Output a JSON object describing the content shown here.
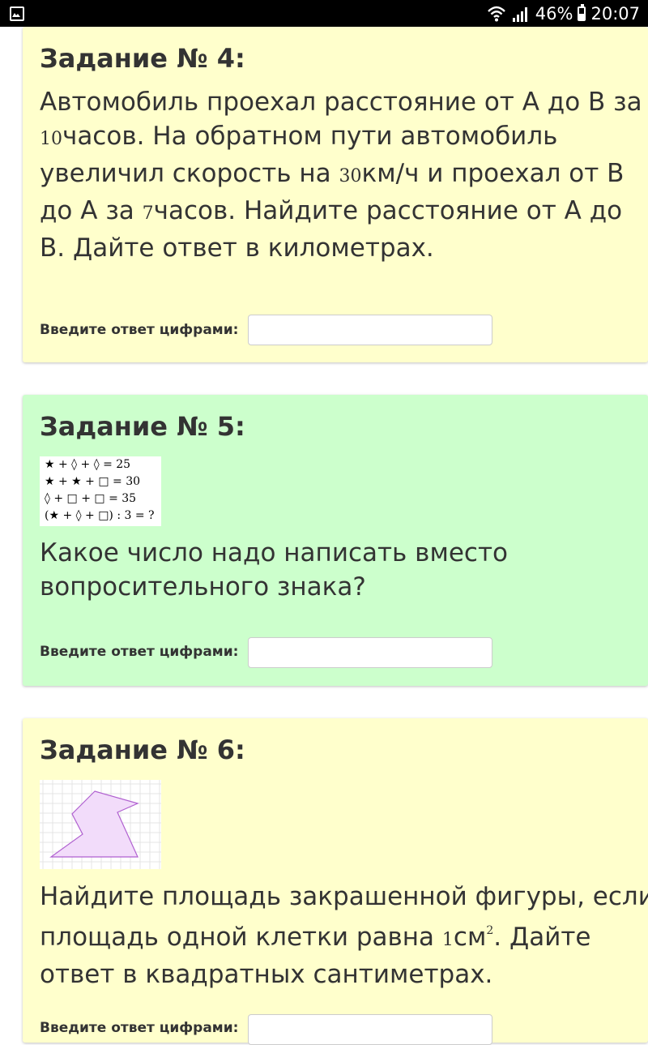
{
  "status_bar": {
    "battery": "46%",
    "time": "20:07",
    "battery_level": 0.46
  },
  "tasks": [
    {
      "title": "Задание № 4:",
      "text_parts": [
        "Автомобиль проехал расстояние от А до В за ",
        "10",
        "часов. На обратном пути автомобиль увеличил скорость на ",
        "30",
        "км/ч и проехал от В до А за ",
        "7",
        "часов. Найдите расстояние от А до В. Дайте ответ в километрах."
      ],
      "answer_label": "Введите ответ цифрами:",
      "answer_value": "",
      "color": "#ffffcc"
    },
    {
      "title": "Задание № 5:",
      "equations": [
        "★ + ◊ + ◊ = 25",
        "★ + ★ + □ = 30",
        "◊ + □ + □ = 35",
        "(★ + ◊ + □) : 3 = ?"
      ],
      "text": "Какое число надо написать вместо вопросительного знака?",
      "answer_label": "Введите ответ цифрами:",
      "answer_value": "",
      "color": "#ccffcc"
    },
    {
      "title": "Задание № 6:",
      "text_parts": [
        "Найдите площадь закрашенной фигуры, если площадь одной клетки равна ",
        "1",
        "см",
        "2",
        ". Дайте ответ в квадратных сантиметрах."
      ],
      "answer_label": "Введите ответ цифрами:",
      "answer_value": "",
      "color": "#ffffcc",
      "figure_color": "#b060d0",
      "figure_fill": "#f2dcfa"
    }
  ]
}
